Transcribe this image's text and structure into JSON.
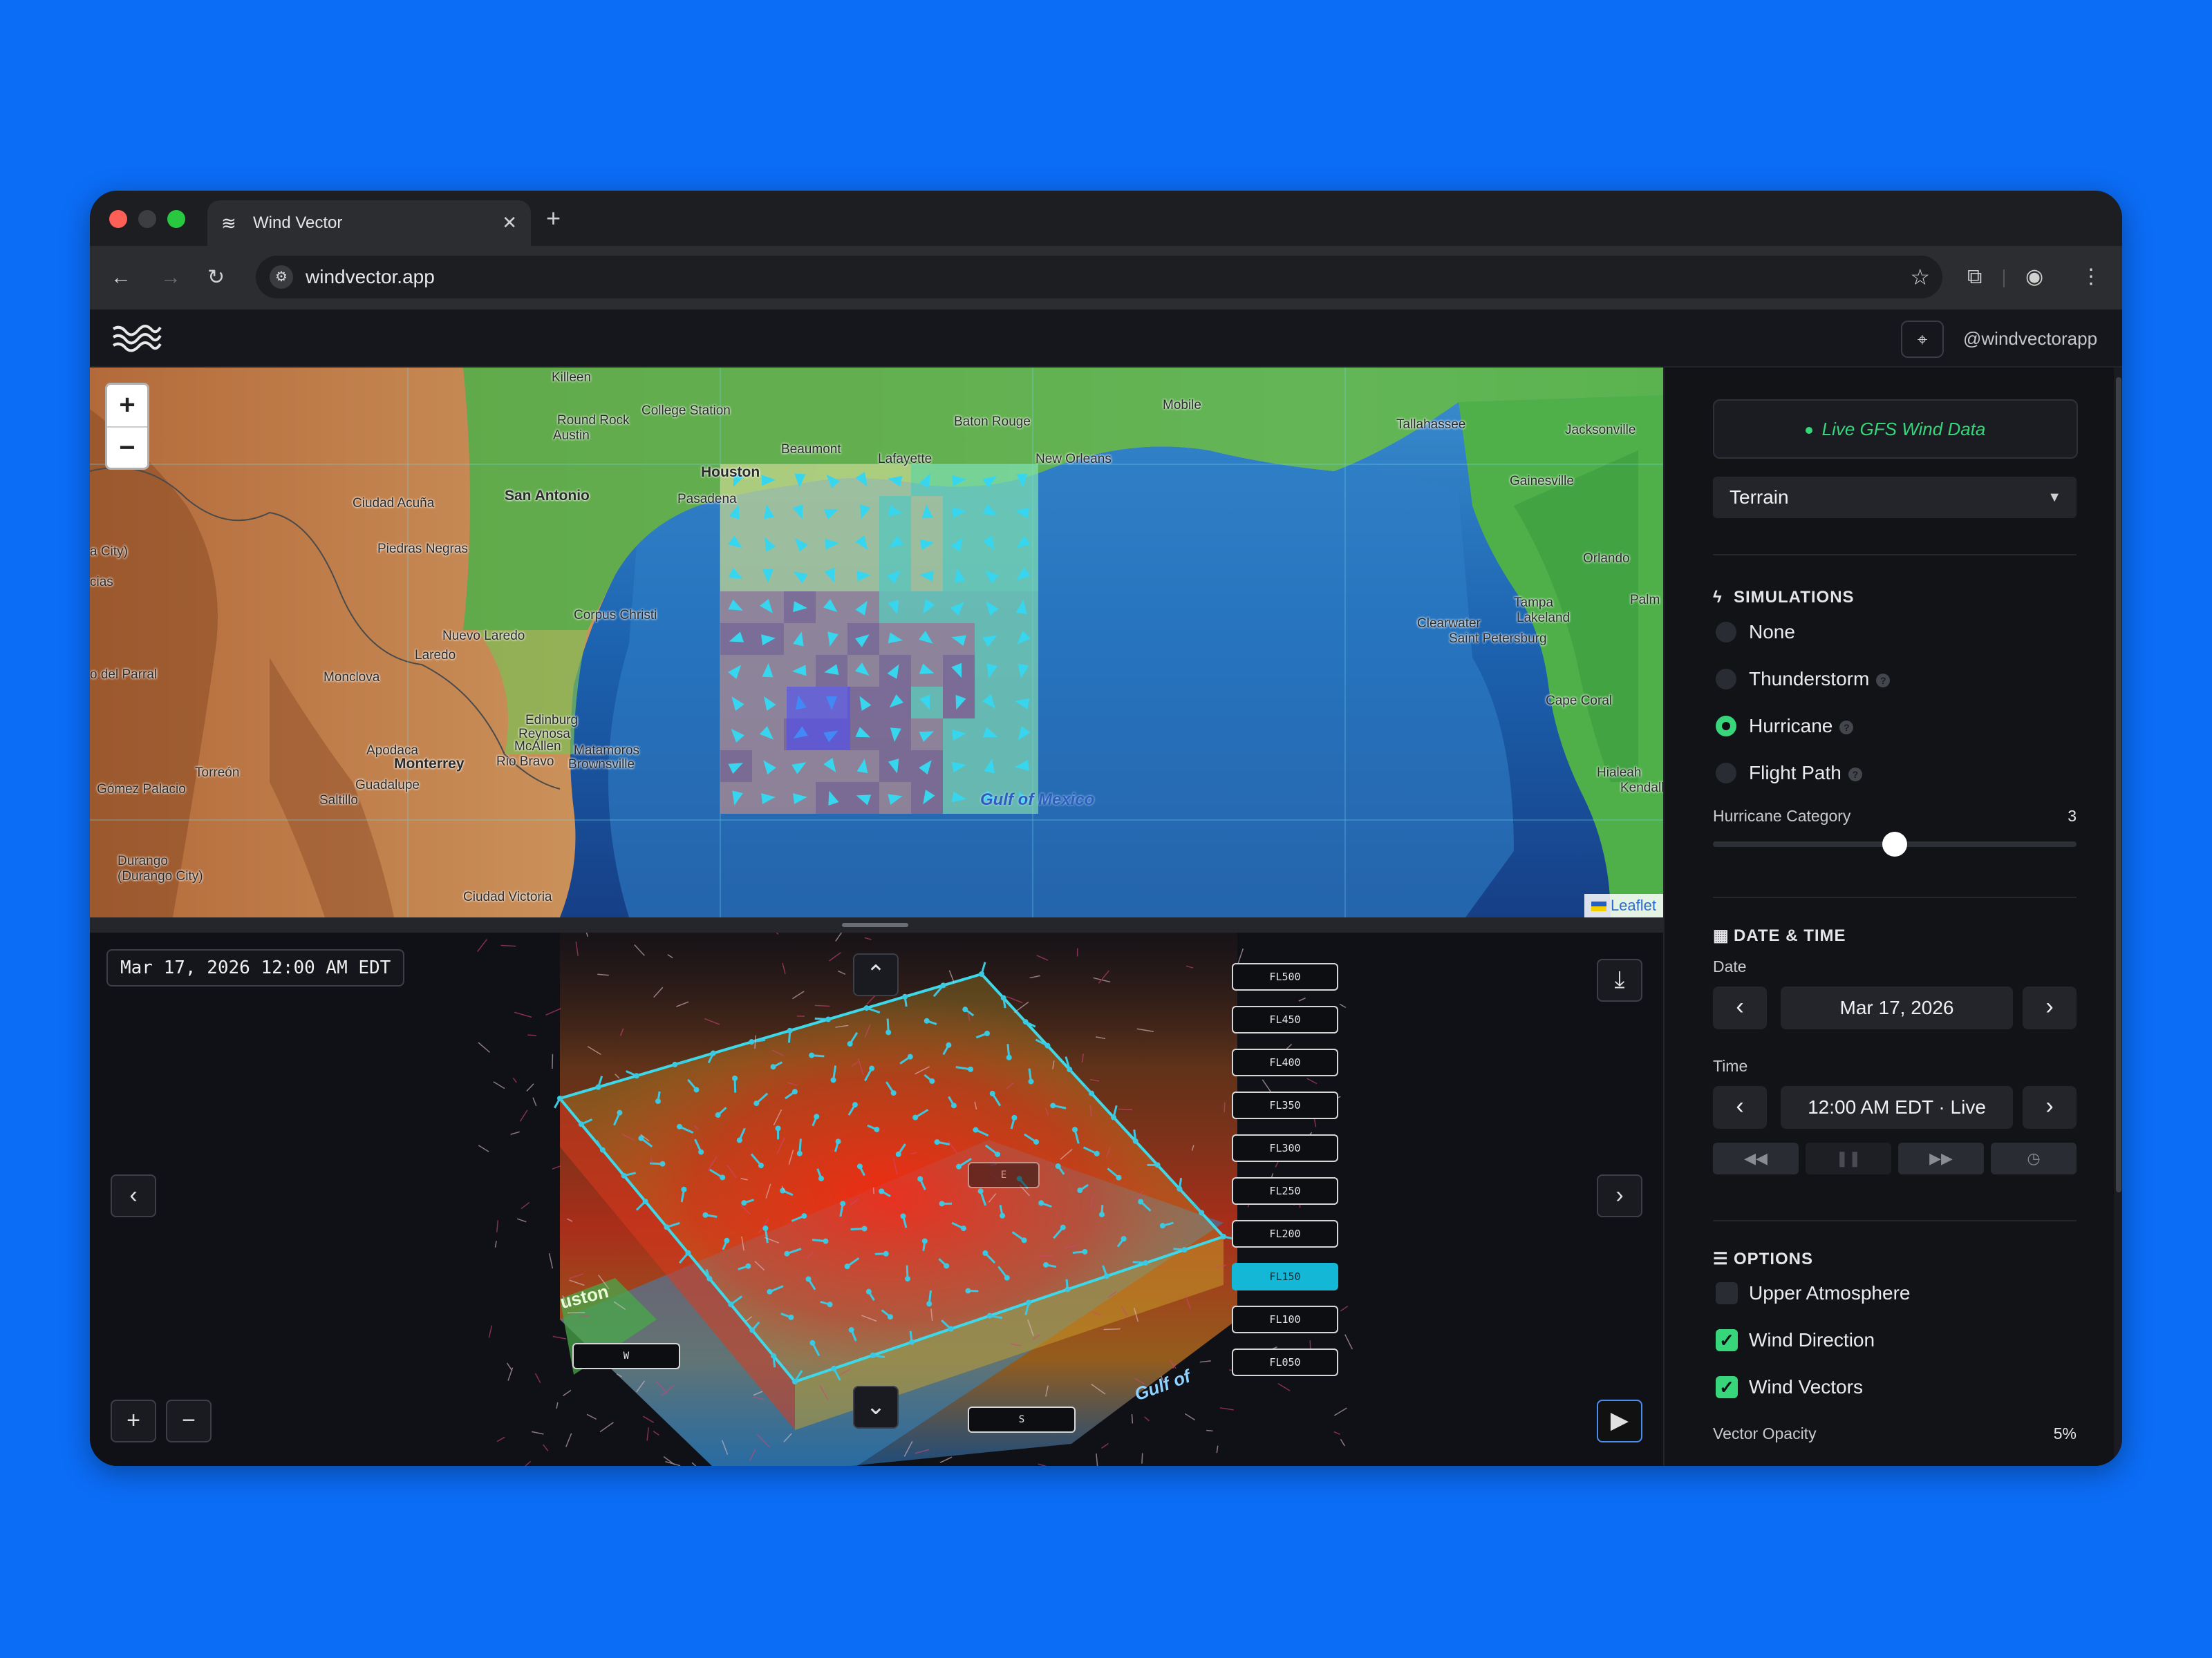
{
  "browser": {
    "tab_title": "Wind Vector",
    "url": "windvector.app",
    "new_tab_icon": "plus-icon",
    "close_icon": "close-icon"
  },
  "app": {
    "handle": "@windvectorapp"
  },
  "map": {
    "zoom_in": "+",
    "zoom_out": "−",
    "attribution": "Leaflet",
    "gulf_label": "Gulf of Mexico",
    "cities": [
      "Killeen",
      "Round Rock",
      "College Station",
      "Austin",
      "Houston",
      "Pasadena",
      "Beaumont",
      "Lafayette",
      "Baton Rouge",
      "New Orleans",
      "Mobile",
      "Tallahassee",
      "Jacksonville",
      "Gainesville",
      "Orlando",
      "Tampa",
      "Lakeland",
      "Clearwater",
      "Saint Petersburg",
      "Palm",
      "Cape Coral",
      "Hialeah",
      "Kendall",
      "San Antonio",
      "Ciudad Acuña",
      "Piedras Negras",
      "Corpus Christi",
      "Nuevo Laredo",
      "Laredo",
      "Monclova",
      "Edinburg",
      "Reynosa",
      "McAllen",
      "Matamoros",
      "Brownsville",
      "Rio Bravo",
      "Monterrey",
      "Apodaca",
      "Guadalupe",
      "Saltillo",
      "Torreón",
      "Gómez Palacio",
      "Durango",
      "(Durango City)",
      "Ciudad Victoria",
      "o del Parral",
      "a City)",
      "cias"
    ]
  },
  "viewer": {
    "timestamp": "Mar 17, 2026 12:00 AM EDT",
    "flight_levels": [
      "FL500",
      "FL450",
      "FL400",
      "FL350",
      "FL300",
      "FL250",
      "FL200",
      "FL150",
      "FL100",
      "FL050"
    ],
    "active_level": "FL150",
    "direction_w": "W",
    "direction_s": "S",
    "direction_e": "E",
    "gulf_label": "Gulf of",
    "city_label": "uston"
  },
  "sidebar": {
    "live_label": "Live GFS Wind Data",
    "layer_select": "Terrain",
    "simulations": {
      "heading": "SIMULATIONS",
      "options": [
        "None",
        "Thunderstorm",
        "Hurricane",
        "Flight Path"
      ],
      "selected": "Hurricane"
    },
    "hurricane_category": {
      "label": "Hurricane Category",
      "value": "3",
      "min": 1,
      "max": 5
    },
    "datetime": {
      "heading": "DATE & TIME",
      "date_label": "Date",
      "date_value": "Mar 17, 2026",
      "time_label": "Time",
      "time_value": "12:00 AM EDT · Live"
    },
    "options": {
      "heading": "OPTIONS",
      "items": [
        {
          "label": "Upper Atmosphere",
          "checked": false
        },
        {
          "label": "Wind Direction",
          "checked": true
        },
        {
          "label": "Wind Vectors",
          "checked": true
        }
      ],
      "vector_opacity_label": "Vector Opacity",
      "vector_opacity_value": "5%"
    }
  },
  "colors": {
    "accent": "#37d67a",
    "active_level": "#14b8d6",
    "wind_box": "#3fd8e8",
    "background": "#0b6cf5"
  }
}
